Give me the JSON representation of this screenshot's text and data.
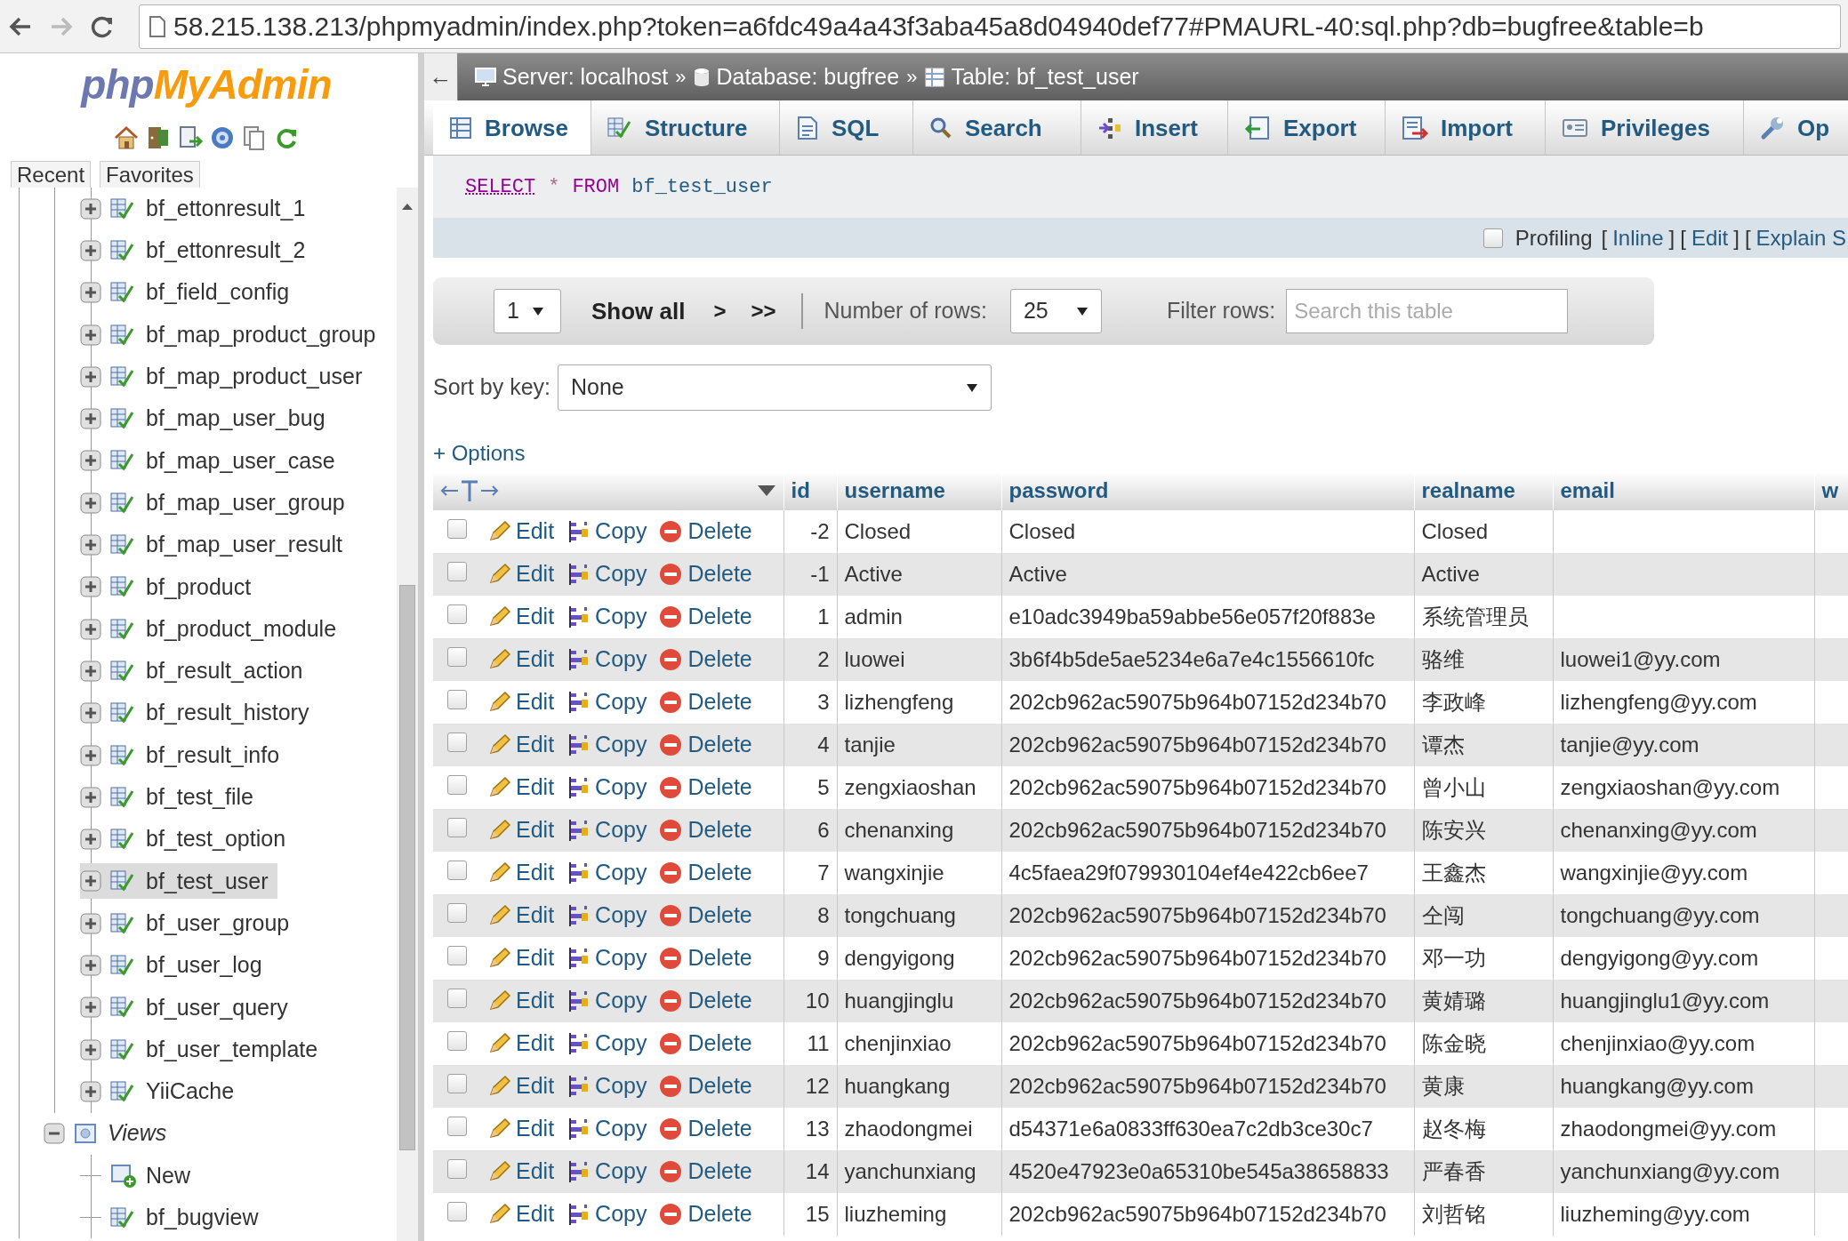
{
  "browser": {
    "url": "58.215.138.213/phpmyadmin/index.php?token=a6fdc49a4a43f3aba45a8d04940def77#PMAURL-40:sql.php?db=bugfree&table=b"
  },
  "sidebar": {
    "logo": {
      "left": "php",
      "right": "MyAdmin"
    },
    "tabs": [
      {
        "label": "Recent"
      },
      {
        "label": "Favorites"
      }
    ],
    "tree": [
      {
        "kind": "group",
        "children": [
          {
            "label": "bf_ettonresult_1",
            "kind": "table",
            "expanded": false,
            "selected": false
          },
          {
            "label": "bf_ettonresult_2",
            "kind": "table",
            "expanded": false,
            "selected": false
          },
          {
            "label": "bf_field_config",
            "kind": "table",
            "expanded": false,
            "selected": false
          },
          {
            "label": "bf_map_product_group",
            "kind": "table",
            "expanded": false,
            "selected": false
          },
          {
            "label": "bf_map_product_user",
            "kind": "table",
            "expanded": false,
            "selected": false
          },
          {
            "label": "bf_map_user_bug",
            "kind": "table",
            "expanded": false,
            "selected": false
          },
          {
            "label": "bf_map_user_case",
            "kind": "table",
            "expanded": false,
            "selected": false
          },
          {
            "label": "bf_map_user_group",
            "kind": "table",
            "expanded": false,
            "selected": false
          },
          {
            "label": "bf_map_user_result",
            "kind": "table",
            "expanded": false,
            "selected": false
          },
          {
            "label": "bf_product",
            "kind": "table",
            "expanded": false,
            "selected": false
          },
          {
            "label": "bf_product_module",
            "kind": "table",
            "expanded": false,
            "selected": false
          },
          {
            "label": "bf_result_action",
            "kind": "table",
            "expanded": false,
            "selected": false
          },
          {
            "label": "bf_result_history",
            "kind": "table",
            "expanded": false,
            "selected": false
          },
          {
            "label": "bf_result_info",
            "kind": "table",
            "expanded": false,
            "selected": false
          },
          {
            "label": "bf_test_file",
            "kind": "table",
            "expanded": false,
            "selected": false
          },
          {
            "label": "bf_test_option",
            "kind": "table",
            "expanded": false,
            "selected": false
          },
          {
            "label": "bf_test_user",
            "kind": "table",
            "expanded": false,
            "selected": true
          },
          {
            "label": "bf_user_group",
            "kind": "table",
            "expanded": false,
            "selected": false
          },
          {
            "label": "bf_user_log",
            "kind": "table",
            "expanded": false,
            "selected": false
          },
          {
            "label": "bf_user_query",
            "kind": "table",
            "expanded": false,
            "selected": false
          },
          {
            "label": "bf_user_template",
            "kind": "table",
            "expanded": false,
            "selected": false
          },
          {
            "label": "YiiCache",
            "kind": "table",
            "expanded": false,
            "selected": false
          }
        ]
      },
      {
        "label": "Views",
        "kind": "group",
        "expanded": true,
        "children": [
          {
            "label": "New",
            "kind": "new"
          },
          {
            "label": "bf_bugview",
            "kind": "view"
          }
        ]
      }
    ]
  },
  "breadcrumb": {
    "collapse": "←",
    "items": [
      {
        "kind": "server",
        "label": "Server: localhost",
        "separator": "»"
      },
      {
        "kind": "database",
        "label": "Database: bugfree",
        "separator": "»"
      },
      {
        "kind": "table",
        "label": "Table: bf_test_user"
      }
    ]
  },
  "tabs": [
    {
      "kind": "browse",
      "label": "Browse",
      "selected": true
    },
    {
      "kind": "structure",
      "label": "Structure",
      "selected": false
    },
    {
      "kind": "sql",
      "label": "SQL",
      "selected": false
    },
    {
      "kind": "search",
      "label": "Search",
      "selected": false
    },
    {
      "kind": "insert",
      "label": "Insert",
      "selected": false
    },
    {
      "kind": "export",
      "label": "Export",
      "selected": false
    },
    {
      "kind": "import",
      "label": "Import",
      "selected": false
    },
    {
      "kind": "privileges",
      "label": "Privileges",
      "selected": false
    },
    {
      "kind": "operations",
      "label": "Op",
      "selected": false
    }
  ],
  "query": [
    {
      "kind": "keyword",
      "text": "SELECT"
    },
    {
      "kind": "operator",
      "text": "*"
    },
    {
      "kind": "keyword",
      "text": "FROM"
    },
    {
      "kind": "identifier",
      "text": "bf_test_user"
    }
  ],
  "profiling": {
    "label": "Profiling",
    "checked": false,
    "links": [
      {
        "open": "[",
        "label": "Inline",
        "close": "]"
      },
      {
        "open": "[",
        "label": "Edit",
        "close": "]"
      },
      {
        "open": "[",
        "label": "Explain S"
      }
    ]
  },
  "navigation": {
    "page": "1",
    "show_all": "Show all",
    "next": ">",
    "last": ">>",
    "rows_label": "Number of rows:",
    "rows": "25",
    "filter_label": "Filter rows:",
    "filter_placeholder": "Search this table"
  },
  "sort": {
    "label": "Sort by key:",
    "value": "None"
  },
  "options_link": "+ Options",
  "table": {
    "columns": [
      {
        "label": "id"
      },
      {
        "label": "username"
      },
      {
        "label": "password"
      },
      {
        "label": "realname"
      },
      {
        "label": "email"
      },
      {
        "label": "w"
      }
    ],
    "rows": [
      {
        "checked": false,
        "edit": "Edit",
        "copy": "Copy",
        "delete": "Delete",
        "id": "-2",
        "username": "Closed",
        "password": "Closed",
        "realname": "Closed"
      },
      {
        "checked": false,
        "edit": "Edit",
        "copy": "Copy",
        "delete": "Delete",
        "id": "-1",
        "username": "Active",
        "password": "Active",
        "realname": "Active"
      },
      {
        "checked": false,
        "edit": "Edit",
        "copy": "Copy",
        "delete": "Delete",
        "id": "1",
        "username": "admin",
        "password": "e10adc3949ba59abbe56e057f20f883e",
        "realname": "系统管理员"
      },
      {
        "checked": false,
        "edit": "Edit",
        "copy": "Copy",
        "delete": "Delete",
        "id": "2",
        "username": "luowei",
        "password": "3b6f4b5de5ae5234e6a7e4c1556610fc",
        "realname": "骆维",
        "email": "luowei1@yy.com"
      },
      {
        "checked": false,
        "edit": "Edit",
        "copy": "Copy",
        "delete": "Delete",
        "id": "3",
        "username": "lizhengfeng",
        "password": "202cb962ac59075b964b07152d234b70",
        "realname": "李政峰",
        "email": "lizhengfeng@yy.com"
      },
      {
        "checked": false,
        "edit": "Edit",
        "copy": "Copy",
        "delete": "Delete",
        "id": "4",
        "username": "tanjie",
        "password": "202cb962ac59075b964b07152d234b70",
        "realname": "谭杰",
        "email": "tanjie@yy.com"
      },
      {
        "checked": false,
        "edit": "Edit",
        "copy": "Copy",
        "delete": "Delete",
        "id": "5",
        "username": "zengxiaoshan",
        "password": "202cb962ac59075b964b07152d234b70",
        "realname": "曾小山",
        "email": "zengxiaoshan@yy.com"
      },
      {
        "checked": false,
        "edit": "Edit",
        "copy": "Copy",
        "delete": "Delete",
        "id": "6",
        "username": "chenanxing",
        "password": "202cb962ac59075b964b07152d234b70",
        "realname": "陈安兴",
        "email": "chenanxing@yy.com"
      },
      {
        "checked": false,
        "edit": "Edit",
        "copy": "Copy",
        "delete": "Delete",
        "id": "7",
        "username": "wangxinjie",
        "password": "4c5faea29f079930104ef4e422cb6ee7",
        "realname": "王鑫杰",
        "email": "wangxinjie@yy.com"
      },
      {
        "checked": false,
        "edit": "Edit",
        "copy": "Copy",
        "delete": "Delete",
        "id": "8",
        "username": "tongchuang",
        "password": "202cb962ac59075b964b07152d234b70",
        "realname": "仝闯",
        "email": "tongchuang@yy.com"
      },
      {
        "checked": false,
        "edit": "Edit",
        "copy": "Copy",
        "delete": "Delete",
        "id": "9",
        "username": "dengyigong",
        "password": "202cb962ac59075b964b07152d234b70",
        "realname": "邓一功",
        "email": "dengyigong@yy.com"
      },
      {
        "checked": false,
        "edit": "Edit",
        "copy": "Copy",
        "delete": "Delete",
        "id": "10",
        "username": "huangjinglu",
        "password": "202cb962ac59075b964b07152d234b70",
        "realname": "黄婧璐",
        "email": "huangjinglu1@yy.com"
      },
      {
        "checked": false,
        "edit": "Edit",
        "copy": "Copy",
        "delete": "Delete",
        "id": "11",
        "username": "chenjinxiao",
        "password": "202cb962ac59075b964b07152d234b70",
        "realname": "陈金晓",
        "email": "chenjinxiao@yy.com"
      },
      {
        "checked": false,
        "edit": "Edit",
        "copy": "Copy",
        "delete": "Delete",
        "id": "12",
        "username": "huangkang",
        "password": "202cb962ac59075b964b07152d234b70",
        "realname": "黄康",
        "email": "huangkang@yy.com"
      },
      {
        "checked": false,
        "edit": "Edit",
        "copy": "Copy",
        "delete": "Delete",
        "id": "13",
        "username": "zhaodongmei",
        "password": "d54371e6a0833ff630ea7c2db3ce30c7",
        "realname": "赵冬梅",
        "email": "zhaodongmei@yy.com"
      },
      {
        "checked": false,
        "edit": "Edit",
        "copy": "Copy",
        "delete": "Delete",
        "id": "14",
        "username": "yanchunxiang",
        "password": "4520e47923e0a65310be545a38658833",
        "realname": "严春香",
        "email": "yanchunxiang@yy.com"
      },
      {
        "checked": false,
        "edit": "Edit",
        "copy": "Copy",
        "delete": "Delete",
        "id": "15",
        "username": "liuzheming",
        "password": "202cb962ac59075b964b07152d234b70",
        "realname": "刘哲铭",
        "email": "liuzheming@yy.com"
      }
    ]
  }
}
